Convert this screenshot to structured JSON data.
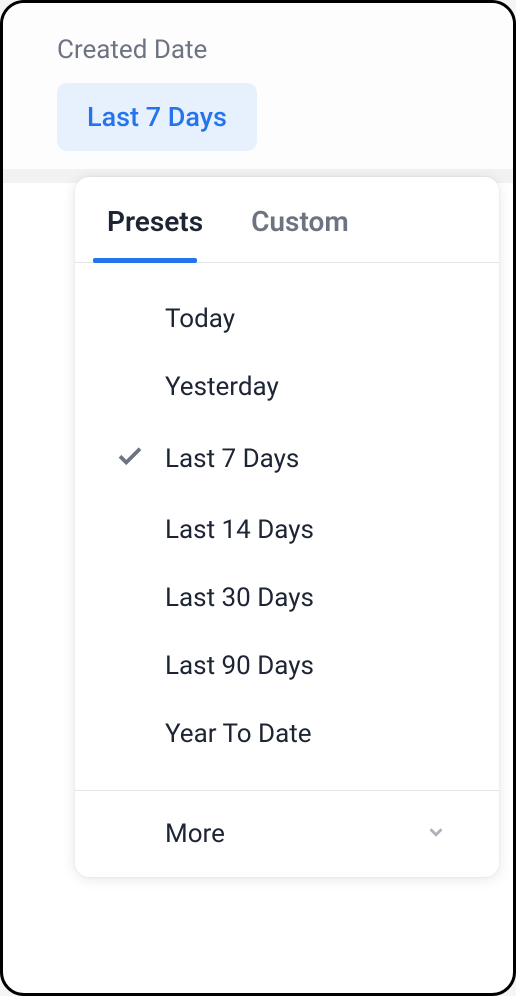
{
  "field": {
    "label": "Created Date",
    "selected_value": "Last 7 Days"
  },
  "tabs": {
    "presets": "Presets",
    "custom": "Custom"
  },
  "options": [
    {
      "label": "Today",
      "selected": false
    },
    {
      "label": "Yesterday",
      "selected": false
    },
    {
      "label": "Last 7 Days",
      "selected": true
    },
    {
      "label": "Last 14 Days",
      "selected": false
    },
    {
      "label": "Last 30 Days",
      "selected": false
    },
    {
      "label": "Last 90 Days",
      "selected": false
    },
    {
      "label": "Year To Date",
      "selected": false
    }
  ],
  "more": {
    "label": "More"
  }
}
